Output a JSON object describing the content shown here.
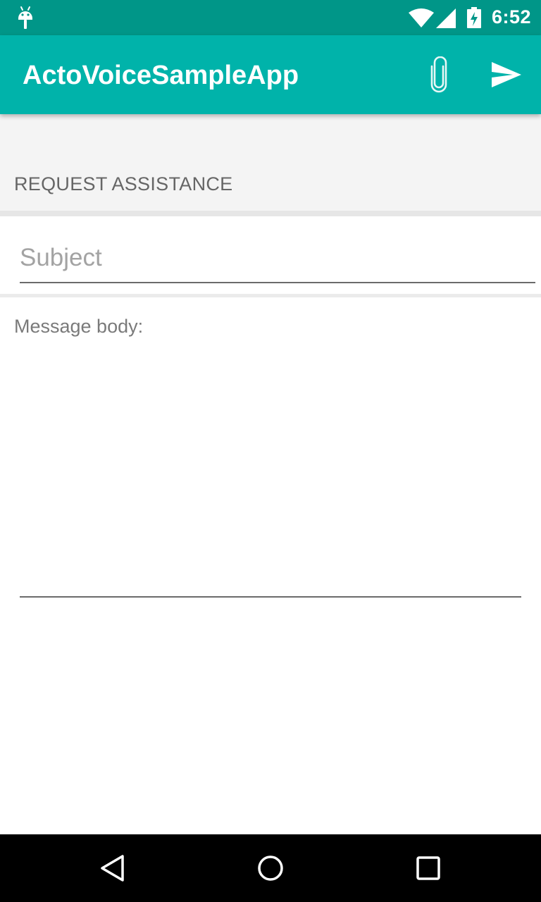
{
  "status_bar": {
    "time": "6:52",
    "icons": [
      "android-icon",
      "wifi-icon",
      "signal-icon",
      "battery-charging-icon"
    ]
  },
  "app_bar": {
    "title": "ActoVoiceSampleApp",
    "actions": [
      "paperclip-icon",
      "send-icon"
    ]
  },
  "section": {
    "title": "REQUEST ASSISTANCE"
  },
  "form": {
    "subject_placeholder": "Subject",
    "subject_value": "",
    "body_label": "Message body:",
    "body_value": ""
  },
  "nav_bar": {
    "buttons": [
      "back-icon",
      "home-icon",
      "recents-icon"
    ]
  },
  "colors": {
    "status_bar": "#009688",
    "app_bar": "#00B3AA",
    "section_background": "#F4F4F4",
    "nav_bar": "#000000"
  }
}
